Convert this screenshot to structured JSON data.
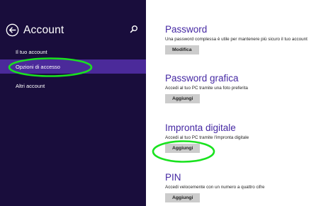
{
  "sidebar": {
    "title": "Account",
    "items": [
      {
        "label": "Il tuo account"
      },
      {
        "label": "Opzioni di accesso"
      },
      {
        "label": "Altri account"
      }
    ]
  },
  "sections": [
    {
      "title": "Password",
      "description": "Una password complessa è utile per mantenere più sicuro il tuo account",
      "button": "Modifica"
    },
    {
      "title": "Password grafica",
      "description": "Accedi al tuo PC tramite una foto preferita",
      "button": "Aggiungi"
    },
    {
      "title": "Impronta digitale",
      "description": "Accedi al tuo PC tramite l'impronta digitale",
      "button": "Aggiungi"
    },
    {
      "title": "PIN",
      "description": "Accedi velocemente con un numero a quattro cifre",
      "button": "Aggiungi"
    }
  ],
  "colors": {
    "sidebar_bg": "#190d3c",
    "active_item": "#4b2a9a",
    "title_accent": "#4528a3",
    "annotation": "#19e21f"
  },
  "icons": [
    "back-arrow-icon",
    "search-icon"
  ]
}
